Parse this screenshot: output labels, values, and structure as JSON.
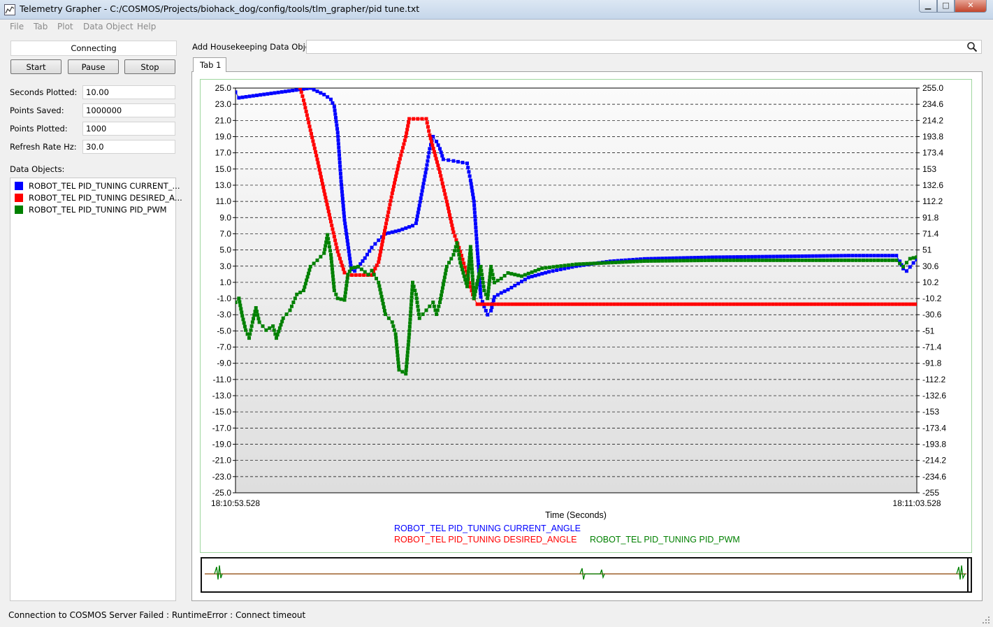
{
  "window": {
    "title": "Telemetry Grapher - C:/COSMOS/Projects/biohack_dog/config/tools/tlm_grapher/pid tune.txt",
    "min_glyph": "▁",
    "max_glyph": "□",
    "close_glyph": "✕"
  },
  "menu": [
    "File",
    "Tab",
    "Plot",
    "Data Object",
    "Help"
  ],
  "left": {
    "status": "Connecting",
    "buttons": {
      "start": "Start",
      "pause": "Pause",
      "stop": "Stop"
    },
    "fields": [
      {
        "label": "Seconds Plotted:",
        "value": "10.00"
      },
      {
        "label": "Points Saved:",
        "value": "1000000"
      },
      {
        "label": "Points Plotted:",
        "value": "1000"
      },
      {
        "label": "Refresh Rate Hz:",
        "value": "30.0"
      }
    ],
    "data_objects_label": "Data Objects:",
    "data_objects": [
      {
        "label": "ROBOT_TEL PID_TUNING CURRENT_...",
        "color": "#0000ff"
      },
      {
        "label": "ROBOT_TEL PID_TUNING DESIRED_A...",
        "color": "#ff0000"
      },
      {
        "label": "ROBOT_TEL PID_TUNING PID_PWM",
        "color": "#008000"
      }
    ]
  },
  "housekeeping": {
    "label": "Add Housekeeping Data Object:",
    "value": ""
  },
  "tabs": [
    {
      "label": "Tab 1"
    }
  ],
  "status_bar": "Connection to COSMOS Server Failed : RuntimeError : Connect timeout",
  "chart_data": {
    "type": "line",
    "xlabel": "Time (Seconds)",
    "x_tick_labels": [
      "18:10:53.528",
      "18:11:03.528"
    ],
    "x_range": [
      0,
      10
    ],
    "y_left_ticks": [
      "25.0",
      "23.0",
      "21.0",
      "19.0",
      "17.0",
      "15.0",
      "13.0",
      "11.0",
      "9.0",
      "7.0",
      "5.0",
      "3.0",
      "1.0",
      "-1.0",
      "-3.0",
      "-5.0",
      "-7.0",
      "-9.0",
      "-11.0",
      "-13.0",
      "-15.0",
      "-17.0",
      "-19.0",
      "-21.0",
      "-23.0",
      "-25.0"
    ],
    "y_right_ticks": [
      "255.0",
      "234.6",
      "214.2",
      "193.8",
      "173.4",
      "153",
      "132.6",
      "112.2",
      "91.8",
      "71.4",
      "51",
      "30.6",
      "10.2",
      "-10.2",
      "-30.6",
      "-51",
      "-71.4",
      "-91.8",
      "-112.2",
      "-132.6",
      "-153",
      "-173.4",
      "-193.8",
      "-214.2",
      "-234.6",
      "-255"
    ],
    "ylim_left": [
      -25,
      25
    ],
    "ylim_right": [
      -255,
      255
    ],
    "grid": true,
    "legend_position": "bottom-center",
    "series": [
      {
        "name": "ROBOT_TEL PID_TUNING CURRENT_ANGLE",
        "color": "#0000ff",
        "axis": "left",
        "points": [
          [
            0,
            24.5
          ],
          [
            0.05,
            23.8
          ],
          [
            1.1,
            25.0
          ],
          [
            1.2,
            24.6
          ],
          [
            1.3,
            24.2
          ],
          [
            1.4,
            23.6
          ],
          [
            1.45,
            22.7
          ],
          [
            1.5,
            19.5
          ],
          [
            1.55,
            13.5
          ],
          [
            1.6,
            8.7
          ],
          [
            1.65,
            5.7
          ],
          [
            1.7,
            2.6
          ],
          [
            1.75,
            2.4
          ],
          [
            1.8,
            2.9
          ],
          [
            1.9,
            4.0
          ],
          [
            2.0,
            5.3
          ],
          [
            2.1,
            6.2
          ],
          [
            2.2,
            7.0
          ],
          [
            2.4,
            7.4
          ],
          [
            2.6,
            8.0
          ],
          [
            2.65,
            8.3
          ],
          [
            2.7,
            10.5
          ],
          [
            2.8,
            15.0
          ],
          [
            2.85,
            17.5
          ],
          [
            2.9,
            19.0
          ],
          [
            2.95,
            18.4
          ],
          [
            3.0,
            17.5
          ],
          [
            3.05,
            16.2
          ],
          [
            3.2,
            16.0
          ],
          [
            3.4,
            15.7
          ],
          [
            3.45,
            13.6
          ],
          [
            3.5,
            11.0
          ],
          [
            3.55,
            5.0
          ],
          [
            3.6,
            -0.8
          ],
          [
            3.65,
            -2.0
          ],
          [
            3.7,
            -3.0
          ],
          [
            3.75,
            -2.5
          ],
          [
            3.8,
            -0.8
          ],
          [
            3.9,
            -0.3
          ],
          [
            4.0,
            0.1
          ],
          [
            4.1,
            0.6
          ],
          [
            4.3,
            1.6
          ],
          [
            4.6,
            2.3
          ],
          [
            5.0,
            3.0
          ],
          [
            5.5,
            3.6
          ],
          [
            6.0,
            3.9
          ],
          [
            7.0,
            4.1
          ],
          [
            8.0,
            4.2
          ],
          [
            9.0,
            4.3
          ],
          [
            9.7,
            4.3
          ],
          [
            9.75,
            3.6
          ],
          [
            9.8,
            2.7
          ],
          [
            9.85,
            2.4
          ],
          [
            9.9,
            2.9
          ],
          [
            9.95,
            3.4
          ],
          [
            10.0,
            3.8
          ]
        ]
      },
      {
        "name": "ROBOT_TEL PID_TUNING DESIRED_ANGLE",
        "color": "#ff0000",
        "axis": "left",
        "points": [
          [
            0.95,
            25.0
          ],
          [
            1.0,
            23.5
          ],
          [
            1.1,
            19.8
          ],
          [
            1.2,
            16.2
          ],
          [
            1.3,
            12.3
          ],
          [
            1.4,
            8.5
          ],
          [
            1.5,
            4.8
          ],
          [
            1.6,
            2.2
          ],
          [
            1.65,
            1.9
          ],
          [
            2.0,
            1.9
          ],
          [
            2.1,
            3.5
          ],
          [
            2.2,
            7.8
          ],
          [
            2.3,
            12.0
          ],
          [
            2.4,
            15.8
          ],
          [
            2.5,
            19.0
          ],
          [
            2.55,
            21.2
          ],
          [
            2.8,
            21.2
          ],
          [
            2.85,
            19.2
          ],
          [
            3.0,
            14.6
          ],
          [
            3.1,
            11.0
          ],
          [
            3.2,
            7.2
          ],
          [
            3.3,
            4.8
          ],
          [
            3.4,
            1.9
          ],
          [
            3.5,
            -1.0
          ],
          [
            3.55,
            -1.7
          ],
          [
            10.0,
            -1.7
          ]
        ]
      },
      {
        "name": "ROBOT_TEL PID_TUNING PID_PWM",
        "color": "#008000",
        "axis": "right",
        "points": [
          [
            0,
            -15
          ],
          [
            0.05,
            -10
          ],
          [
            0.1,
            -32
          ],
          [
            0.15,
            -50
          ],
          [
            0.2,
            -60
          ],
          [
            0.25,
            -40
          ],
          [
            0.3,
            -22
          ],
          [
            0.35,
            -40
          ],
          [
            0.45,
            -50
          ],
          [
            0.55,
            -45
          ],
          [
            0.6,
            -60
          ],
          [
            0.7,
            -35
          ],
          [
            0.8,
            -25
          ],
          [
            0.9,
            -5
          ],
          [
            1.0,
            0
          ],
          [
            1.1,
            30
          ],
          [
            1.2,
            38
          ],
          [
            1.3,
            47
          ],
          [
            1.35,
            70
          ],
          [
            1.4,
            45
          ],
          [
            1.45,
            0
          ],
          [
            1.5,
            -10
          ],
          [
            1.6,
            -12
          ],
          [
            1.65,
            20
          ],
          [
            1.7,
            28
          ],
          [
            1.8,
            30
          ],
          [
            1.95,
            20
          ],
          [
            2.0,
            25
          ],
          [
            2.1,
            10
          ],
          [
            2.2,
            -30
          ],
          [
            2.3,
            -40
          ],
          [
            2.35,
            -55
          ],
          [
            2.4,
            -100
          ],
          [
            2.5,
            -105
          ],
          [
            2.55,
            -55
          ],
          [
            2.6,
            10
          ],
          [
            2.65,
            -5
          ],
          [
            2.7,
            -35
          ],
          [
            2.8,
            -25
          ],
          [
            2.9,
            -15
          ],
          [
            2.95,
            -30
          ],
          [
            3.0,
            -15
          ],
          [
            3.1,
            30
          ],
          [
            3.2,
            45
          ],
          [
            3.25,
            60
          ],
          [
            3.3,
            35
          ],
          [
            3.4,
            5
          ],
          [
            3.45,
            55
          ],
          [
            3.5,
            -10
          ],
          [
            3.6,
            30
          ],
          [
            3.65,
            0
          ],
          [
            3.7,
            -10
          ],
          [
            3.75,
            30
          ],
          [
            3.8,
            10
          ],
          [
            3.9,
            15
          ],
          [
            4.0,
            22
          ],
          [
            4.2,
            18
          ],
          [
            4.5,
            28
          ],
          [
            5.0,
            33
          ],
          [
            6.0,
            37
          ],
          [
            7.0,
            38
          ],
          [
            8.0,
            38
          ],
          [
            9.0,
            38
          ],
          [
            9.7,
            38
          ],
          [
            9.8,
            30
          ],
          [
            9.9,
            40
          ],
          [
            10.0,
            42
          ]
        ]
      }
    ]
  }
}
